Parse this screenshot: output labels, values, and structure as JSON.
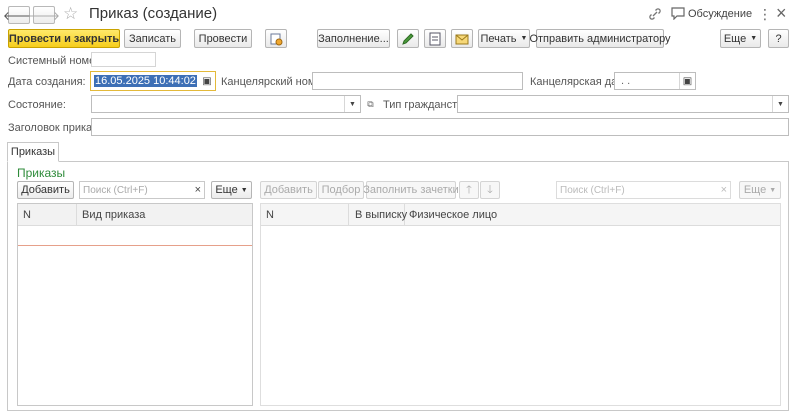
{
  "window": {
    "title": "Приказ (создание)",
    "discussion_label": "Обсуждение",
    "more_icon": "⋮",
    "close_icon": "×"
  },
  "toolbar": {
    "post_close_label": "Провести и закрыть",
    "save_label": "Записать",
    "post_label": "Провести",
    "fill_label": "Заполнение...",
    "print_label": "Печать",
    "send_admin_label": "Отправить администратору",
    "more_label": "Еще",
    "help_label": "?"
  },
  "form": {
    "system_number_label": "Системный номер:",
    "system_number_value": "",
    "created_date_label": "Дата создания:",
    "created_date_value": "16.05.2025 10:44:02",
    "office_number_label": "Канцелярский номер:",
    "office_number_value": "",
    "office_date_label": "Канцелярская дата:",
    "office_date_value": " .  .",
    "state_label": "Состояние:",
    "state_value": "",
    "citizenship_label": "Тип гражданства:",
    "citizenship_value": "",
    "header_label": "Заголовок приказа:",
    "header_value": ""
  },
  "tabs": [
    {
      "label": "Приказы",
      "active": true
    }
  ],
  "orders_section": {
    "title": "Приказы",
    "left": {
      "add_label": "Добавить",
      "search_placeholder": "Поиск (Ctrl+F)",
      "more_label": "Еще",
      "columns": [
        "N",
        "Вид приказа"
      ]
    },
    "right": {
      "add_label": "Добавить",
      "select_label": "Подбор",
      "fill_records_label": "Заполнить зачетки",
      "search_placeholder": "Поиск (Ctrl+F)",
      "more_label": "Еще",
      "columns": [
        "N",
        "В выписку",
        "Физическое лицо"
      ]
    }
  },
  "colors": {
    "accent_yellow": "#f6cd1c",
    "section_green": "#2e8b3a",
    "date_highlight": "#3d6fb6",
    "row_marker": "#e6a08a"
  }
}
